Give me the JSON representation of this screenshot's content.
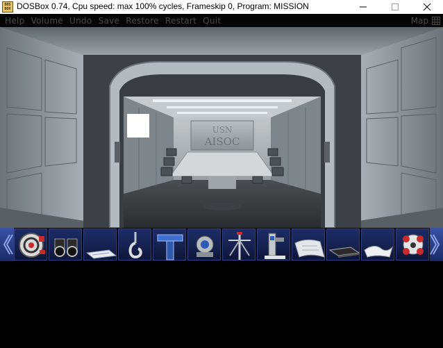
{
  "window": {
    "title": "DOSBox 0.74, Cpu speed: max 100% cycles, Frameskip  0, Program:  MISSION",
    "icon_text": "DOS BOX",
    "controls": [
      "minimize-icon",
      "maximize-icon",
      "close-icon"
    ]
  },
  "menu": {
    "items": [
      "Help",
      "Volume",
      "Undo",
      "Save",
      "Restore",
      "Restart",
      "Quit"
    ],
    "map_label": "Map"
  },
  "scene": {
    "room": "conference room",
    "screen_text_line1": "USN",
    "screen_text_line2": "AISOC",
    "colors": {
      "wall": "#8e959b",
      "frame": "#b9c0c6",
      "dark": "#3a3d41"
    }
  },
  "inventory": {
    "items": [
      "red-gear-device-icon",
      "binoculars-icon",
      "folder-document-icon",
      "hook-tool-icon",
      "blue-t-pipe-icon",
      "diving-helmet-icon",
      "antenna-mast-icon",
      "machine-tool-icon",
      "paper-sheet-icon",
      "black-box-icon",
      "white-cloth-icon",
      "red-robot-device-icon"
    ],
    "colors": {
      "slot": "#1d2c66",
      "arrow": "#3a52a4"
    }
  }
}
